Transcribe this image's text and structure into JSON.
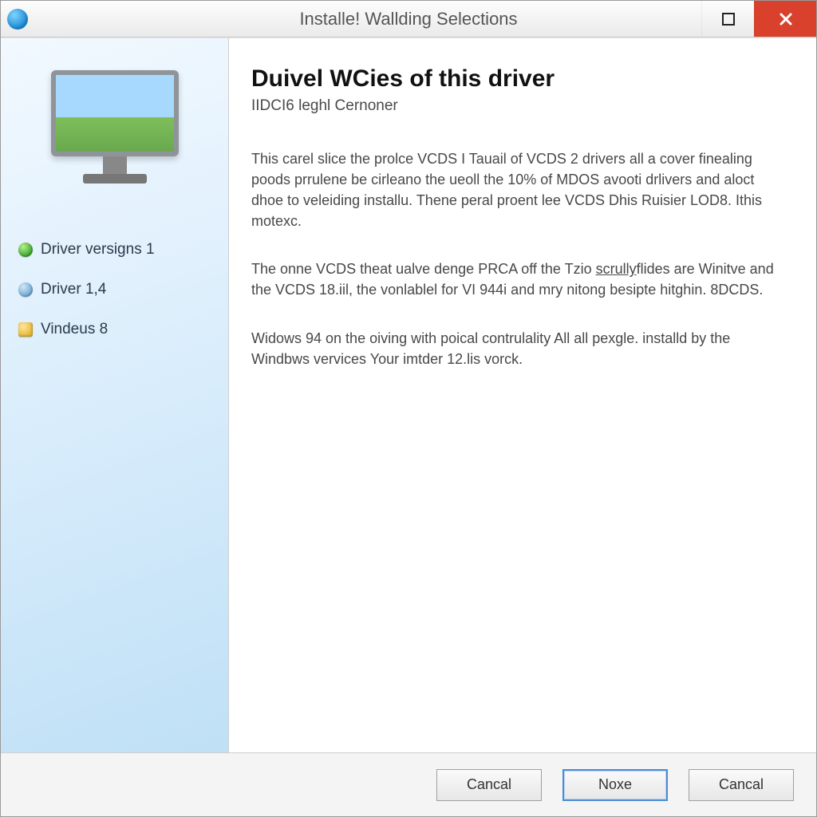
{
  "titlebar": {
    "title": "Installe! Wallding Selections"
  },
  "sidebar": {
    "items": [
      {
        "label": "Driver versigns 1",
        "bullet": "green"
      },
      {
        "label": "Driver 1,4",
        "bullet": "blue"
      },
      {
        "label": "Vindeus 8",
        "bullet": "yellow"
      }
    ]
  },
  "main": {
    "heading": "Duivel WCies of this driver",
    "subtitle": "IIDCI6 leghl Cernoner",
    "para1": "This carel slice the prolce VCDS I Tauail of VCDS 2 drivers all a cover finealing poods prrulene be cirleano the ueoll the 10% of MDOS avooti drlivers and aloct dhoe to veleiding installu. Thene peral proent lee VCDS Dhis Ruisier LOD8. Ithis motexc.",
    "para2a": "The onne VCDS theat ualve denge PRCA off the Tzio ",
    "para2_link": "scrully",
    "para2b": "flides are Winitve and the VCDS 18.iil, the vonlablel for VI 944i and mry nitong besipte hitghin. 8DCDS.",
    "para3": "Widows 94 on the oiving with poical contrulality All all pexgle. installd by the Windbws vervices Your imtder 12.lis vorck."
  },
  "footer": {
    "cancel_left": "Cancal",
    "next": "Noxe",
    "cancel_right": "Cancal"
  }
}
